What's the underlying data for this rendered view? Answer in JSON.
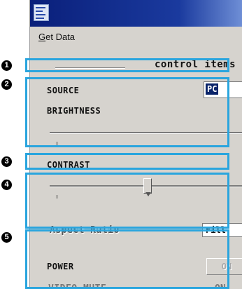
{
  "window": {
    "menu": [
      {
        "accel": "G",
        "rest": "et Data"
      }
    ]
  },
  "group": {
    "title": "control items"
  },
  "controls": {
    "source": {
      "label": "SOURCE",
      "value": "PC"
    },
    "brightness": {
      "label": "BRIGHTNESS",
      "level_percent": 3
    },
    "contrast": {
      "label": "CONTRAST",
      "level_percent": 50
    },
    "aspect_ratio": {
      "label": "Aspect Ratio",
      "value": "Fill"
    },
    "power": {
      "label": "POWER",
      "value": "ON"
    },
    "video_mute": {
      "label": "VIDEO MUTE",
      "value": "ON"
    }
  },
  "markers": [
    "1",
    "2",
    "3",
    "4",
    "5"
  ],
  "colors": {
    "callout": "#2aa5de",
    "titlebar": "#0a1f7a",
    "selection": "#0a246a"
  }
}
